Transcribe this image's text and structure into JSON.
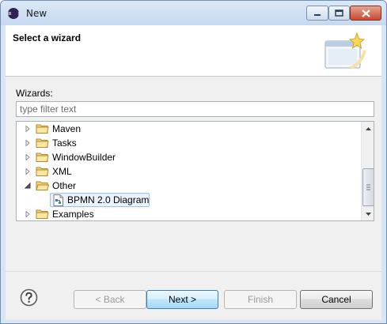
{
  "window": {
    "title": "New"
  },
  "header": {
    "title": "Select a wizard"
  },
  "wizards": {
    "label": "Wizards:",
    "filter_value": "",
    "filter_placeholder": "type filter text"
  },
  "tree": {
    "items": [
      {
        "label": "Maven",
        "expanded": false,
        "level": 0
      },
      {
        "label": "Tasks",
        "expanded": false,
        "level": 0
      },
      {
        "label": "WindowBuilder",
        "expanded": false,
        "level": 0
      },
      {
        "label": "XML",
        "expanded": false,
        "level": 0
      },
      {
        "label": "Other",
        "expanded": true,
        "level": 0
      },
      {
        "label": "BPMN 2.0 Diagram",
        "expanded": null,
        "level": 1,
        "selected": true
      },
      {
        "label": "Examples",
        "expanded": false,
        "level": 0
      }
    ]
  },
  "buttons": {
    "back": "< Back",
    "next": "Next >",
    "finish": "Finish",
    "cancel": "Cancel"
  },
  "colors": {
    "title_bar": "#c6d9ef",
    "dialog_bg": "#f0f0f0",
    "selection_bg": "#eaf3fd",
    "selection_border": "#9ac2ea",
    "folder": "#e8c15a",
    "default_button": "#a7d9f5"
  },
  "icons": {
    "app": "eclipse-icon",
    "help": "help-icon",
    "folder": "folder-icon",
    "file": "bpmn-file-icon",
    "wizard_banner": "new-wizard-banner-icon"
  }
}
